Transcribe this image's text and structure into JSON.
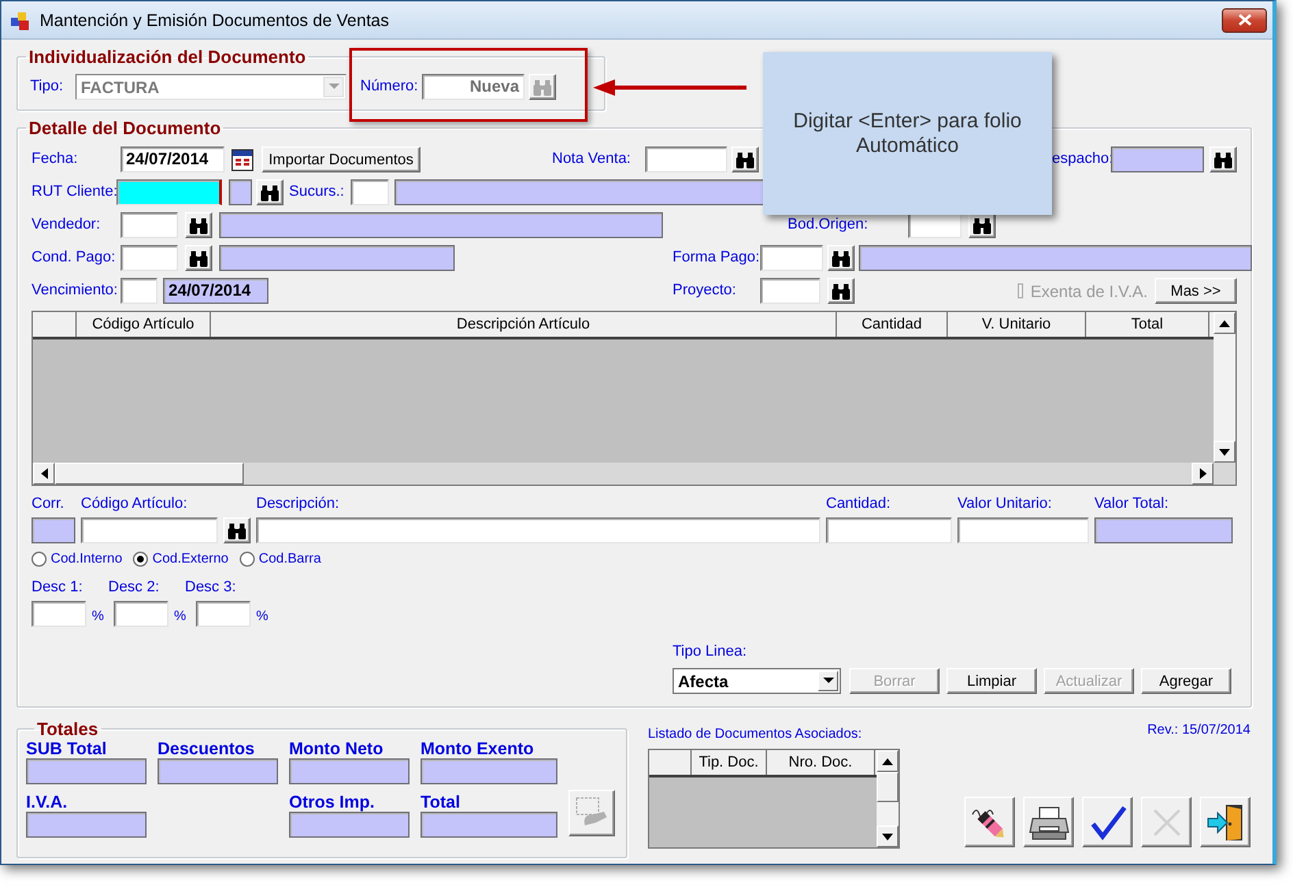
{
  "window": {
    "title": "Mantención y Emisión Documentos de Ventas"
  },
  "identification": {
    "title": "Individualización del Documento",
    "type_label": "Tipo:",
    "type_value": "FACTURA",
    "type_disabled": true,
    "number_label": "Número:",
    "number_value": "Nueva",
    "lookup_disabled": true
  },
  "callout": {
    "text": "Digitar <Enter> para folio Automático"
  },
  "detail": {
    "title": "Detalle del Documento",
    "rows": [
      {
        "items": [
          {
            "kind": "label",
            "text": "Fecha:"
          },
          {
            "kind": "field",
            "value": "24/07/2014",
            "readonly": false,
            "focused": false
          },
          {
            "kind": "calendar"
          },
          {
            "kind": "button",
            "label": "Importar Documentos"
          },
          {
            "kind": "label",
            "text": "Nota Venta:"
          },
          {
            "kind": "field",
            "readonly": false,
            "focused": false
          },
          {
            "kind": "lookup"
          },
          {
            "kind": "label",
            "text": "espacho:"
          },
          {
            "kind": "field",
            "readonly": true,
            "focused": false
          },
          {
            "kind": "lookup"
          }
        ]
      },
      {
        "items": [
          {
            "kind": "label",
            "text": "RUT Cliente:"
          },
          {
            "kind": "field",
            "readonly": false,
            "focused": true
          },
          {
            "kind": "field",
            "readonly": true,
            "focused": false
          },
          {
            "kind": "lookup"
          },
          {
            "kind": "label",
            "text": "Sucurs.:"
          },
          {
            "kind": "field",
            "readonly": false,
            "focused": false
          },
          {
            "kind": "field",
            "readonly": true,
            "focused": false
          }
        ]
      },
      {
        "items": [
          {
            "kind": "label",
            "text": "Vendedor:"
          },
          {
            "kind": "field",
            "readonly": false,
            "focused": false
          },
          {
            "kind": "lookup"
          },
          {
            "kind": "field",
            "readonly": true,
            "focused": false
          },
          {
            "kind": "label",
            "text": "Bod.Origen:"
          },
          {
            "kind": "field",
            "readonly": false,
            "focused": false
          },
          {
            "kind": "lookup"
          }
        ]
      },
      {
        "items": [
          {
            "kind": "label",
            "text": "Cond. Pago:"
          },
          {
            "kind": "field",
            "readonly": false,
            "focused": false
          },
          {
            "kind": "lookup"
          },
          {
            "kind": "field",
            "readonly": true,
            "focused": false
          },
          {
            "kind": "label",
            "text": "Forma Pago:"
          },
          {
            "kind": "field",
            "readonly": false,
            "focused": false
          },
          {
            "kind": "lookup"
          },
          {
            "kind": "field",
            "readonly": true,
            "focused": false
          }
        ]
      },
      {
        "items": [
          {
            "kind": "label",
            "text": "Vencimiento:"
          },
          {
            "kind": "field",
            "readonly": false,
            "focused": false
          },
          {
            "kind": "field",
            "value": "24/07/2014",
            "readonly": true,
            "focused": false
          },
          {
            "kind": "label",
            "text": "Proyecto:"
          },
          {
            "kind": "field",
            "readonly": false,
            "focused": false
          },
          {
            "kind": "lookup"
          },
          {
            "kind": "checkbox",
            "label": "Exenta de I.V.A.",
            "checked": false,
            "disabled": true
          },
          {
            "kind": "button",
            "label": "Mas >>"
          }
        ]
      }
    ]
  },
  "grid": {
    "columns": [
      "Código Artículo",
      "Descripción Artículo",
      "Cantidad",
      "V. Unitario",
      "Total"
    ]
  },
  "entry": {
    "columns": [
      {
        "label": "Corr.",
        "readonly": true
      },
      {
        "label": "Código Artículo:",
        "readonly": false
      },
      {
        "label": "Descripción:",
        "readonly": false
      },
      {
        "label": "Cantidad:",
        "readonly": false
      },
      {
        "label": "Valor Unitario:",
        "readonly": false
      },
      {
        "label": "Valor Total:",
        "readonly": true
      }
    ],
    "code_types": [
      {
        "label": "Cod.Interno",
        "selected": false
      },
      {
        "label": "Cod.Externo",
        "selected": true
      },
      {
        "label": "Cod.Barra",
        "selected": false
      }
    ],
    "discounts": [
      {
        "label": "Desc 1:",
        "unit": "%"
      },
      {
        "label": "Desc 2:",
        "unit": "%"
      },
      {
        "label": "Desc 3:",
        "unit": "%"
      }
    ]
  },
  "line": {
    "label": "Tipo Linea:",
    "value": "Afecta",
    "actions": [
      {
        "label": "Borrar",
        "disabled": true
      },
      {
        "label": "Limpiar",
        "disabled": false
      },
      {
        "label": "Actualizar",
        "disabled": true
      },
      {
        "label": "Agregar",
        "disabled": false
      }
    ]
  },
  "totals": {
    "title": "Totales",
    "fields": [
      {
        "label": "SUB Total",
        "readonly": true
      },
      {
        "label": "Descuentos",
        "readonly": true
      },
      {
        "label": "Monto Neto",
        "readonly": true
      },
      {
        "label": "Monto Exento",
        "readonly": true
      },
      {
        "label": "I.V.A.",
        "readonly": true
      },
      {
        "label": "Otros Imp.",
        "readonly": true
      },
      {
        "label": "Total",
        "readonly": true
      }
    ],
    "button_disabled": true
  },
  "linked_documents": {
    "title": "Listado de Documentos Asociados:",
    "columns": [
      "Tip. Doc.",
      "Nro. Doc."
    ]
  },
  "revision": "Rev.: 15/07/2014",
  "toolbar": [
    {
      "kind": "pencil",
      "disabled": false
    },
    {
      "kind": "print",
      "disabled": false
    },
    {
      "kind": "confirm",
      "disabled": false
    },
    {
      "kind": "cancel",
      "disabled": true
    },
    {
      "kind": "exit",
      "disabled": false
    }
  ]
}
